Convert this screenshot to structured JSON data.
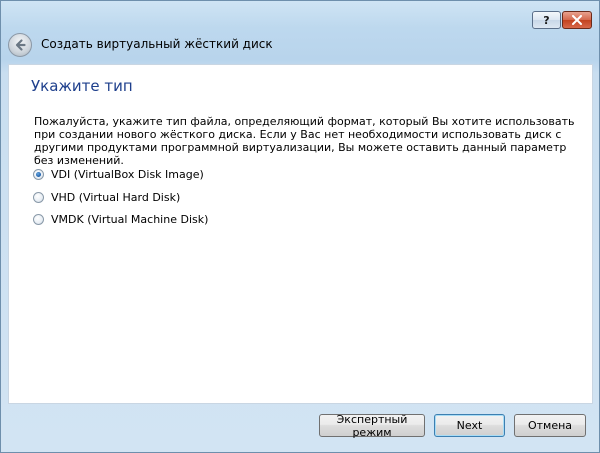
{
  "window": {
    "title": "Создать виртуальный жёсткий диск",
    "help_label": "?",
    "close_label": "×"
  },
  "page": {
    "heading": "Укажите тип",
    "description": "Пожалуйста, укажите тип файла, определяющий формат, который Вы хотите использовать при создании нового жёсткого диска. Если у Вас нет необходимости использовать диск с другими продуктами программной виртуализации, Вы можете оставить данный параметр без изменений."
  },
  "options": [
    {
      "label": "VDI (VirtualBox Disk Image)",
      "checked": true
    },
    {
      "label": "VHD (Virtual Hard Disk)",
      "checked": false
    },
    {
      "label": "VMDK (Virtual Machine Disk)",
      "checked": false
    }
  ],
  "buttons": {
    "expert": "Экспертный режим",
    "next": "Next",
    "cancel": "Отмена"
  },
  "icons": {
    "back": "back-arrow-icon",
    "help": "help-icon",
    "close": "close-icon"
  }
}
